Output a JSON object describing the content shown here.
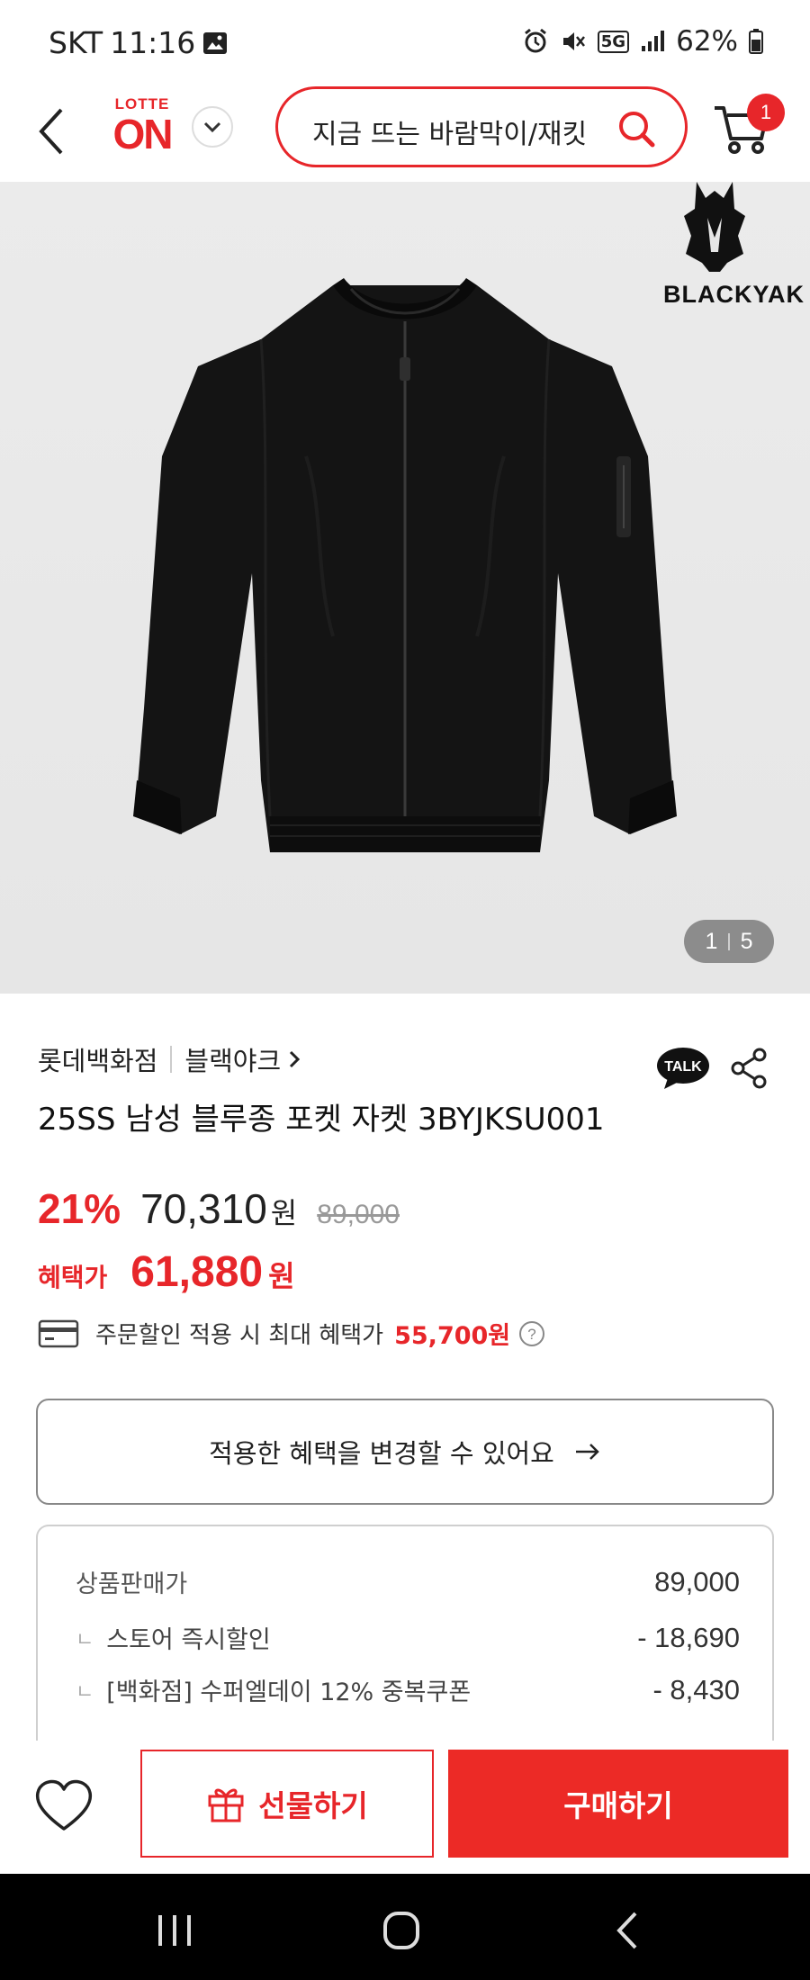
{
  "status_bar": {
    "carrier": "SKT",
    "time": "11:16",
    "network": "5G",
    "battery": "62%"
  },
  "header": {
    "logo_top": "LOTTE",
    "logo_main": "ON",
    "search_text": "지금 뜨는 바람막이/재킷",
    "cart_count": "1"
  },
  "hero": {
    "brand_logo_text": "BLACKYAK",
    "pager_current": "1",
    "pager_total": "5"
  },
  "product": {
    "seller": "롯데백화점",
    "brand": "블랙야크",
    "title": "25SS 남성 블루종 포켓 자켓 3BYJKSU001",
    "discount": "21%",
    "price": "70,310",
    "price_unit": "원",
    "original_price": "89,000",
    "benefit_label": "혜택가",
    "benefit_price": "61,880",
    "benefit_unit": "원",
    "max_benefit_text": "주문할인 적용 시 최대 혜택가",
    "max_benefit_price": "55,700원",
    "talk_label": "TALK"
  },
  "change_benefit_button": "적용한 혜택을 변경할 수 있어요",
  "breakdown": {
    "rows": [
      {
        "label": "상품판매가",
        "value": "89,000"
      },
      {
        "label": "스토어 즉시할인",
        "value": "- 18,690"
      },
      {
        "label": "[백화점] 수퍼엘데이 12% 중복쿠폰",
        "value": "- 8,430"
      }
    ]
  },
  "actions": {
    "gift_label": "선물하기",
    "buy_label": "구매하기"
  },
  "colors": {
    "accent": "#e7262a",
    "buy_button": "#ec2a26"
  }
}
